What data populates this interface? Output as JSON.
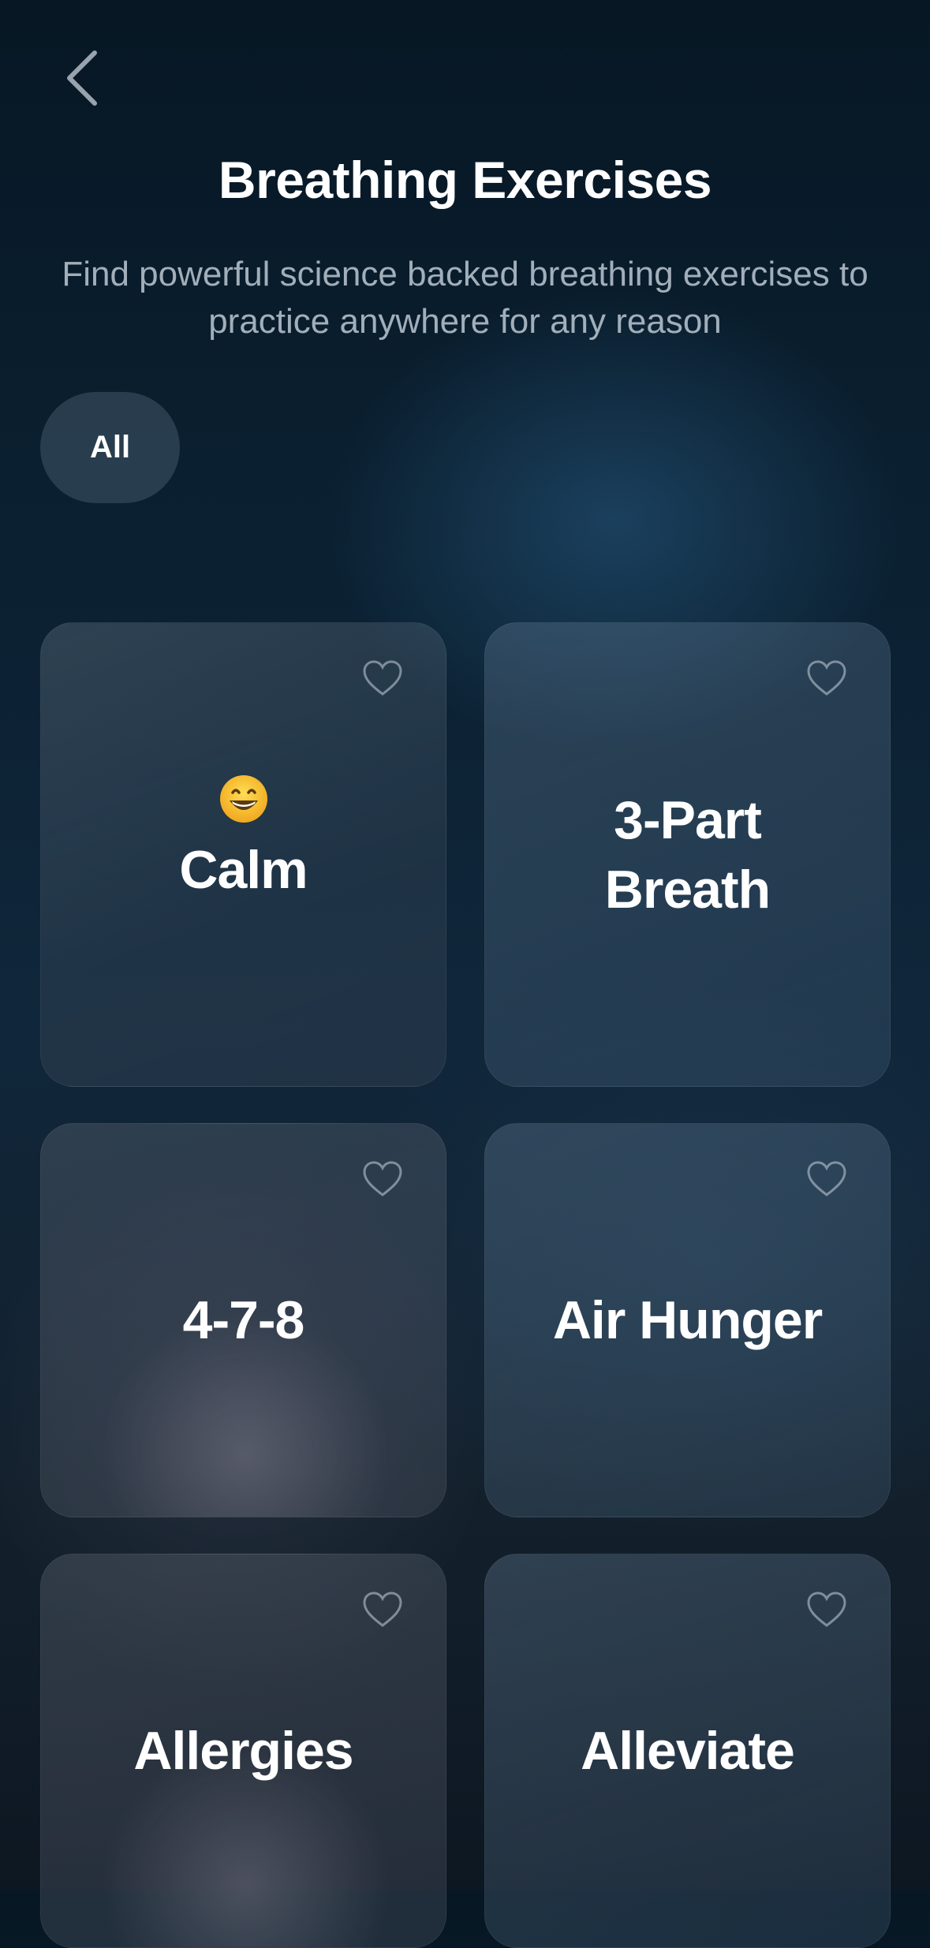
{
  "header": {
    "title": "Breathing Exercises",
    "subtitle": "Find powerful science backed breathing exercises to practice anywhere for any reason"
  },
  "filters": {
    "selected": "All"
  },
  "exercises": [
    {
      "label": "Calm",
      "emoji": "grinning-face",
      "favorited": false
    },
    {
      "label": "3-Part Breath",
      "favorited": false
    },
    {
      "label": "4-7-8",
      "favorited": false
    },
    {
      "label": "Air Hunger",
      "favorited": false
    },
    {
      "label": "Allergies",
      "favorited": false
    },
    {
      "label": "Alleviate",
      "favorited": false
    }
  ],
  "colors": {
    "text_primary": "#ffffff",
    "text_secondary": "#cdd7e1",
    "background_top": "#071724",
    "emoji_yellow": "#f7c52b"
  }
}
